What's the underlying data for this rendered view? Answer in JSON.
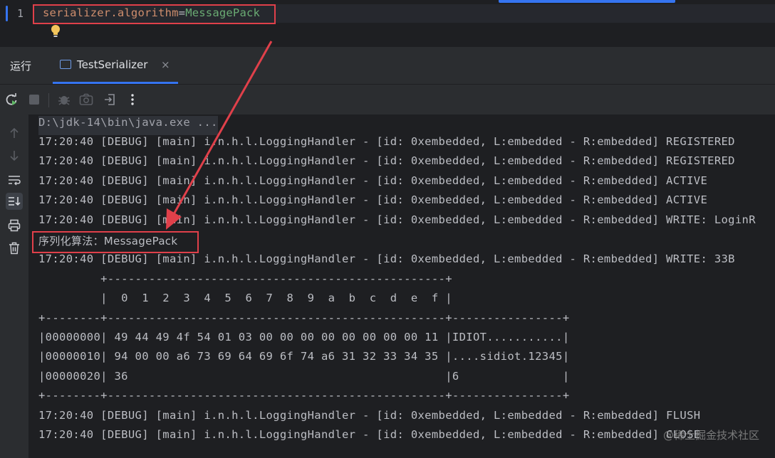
{
  "editor": {
    "line_number": "1",
    "code_key": "serializer.algorithm",
    "code_eq": "=",
    "code_value": "MessagePack"
  },
  "tabs": {
    "run_label": "运行",
    "active_tab": "TestSerializer",
    "close_glyph": "×"
  },
  "console": {
    "lines": [
      "D:\\jdk-14\\bin\\java.exe ...",
      "17:20:40 [DEBUG] [main] i.n.h.l.LoggingHandler - [id: 0xembedded, L:embedded - R:embedded] REGISTERED",
      "17:20:40 [DEBUG] [main] i.n.h.l.LoggingHandler - [id: 0xembedded, L:embedded - R:embedded] REGISTERED",
      "17:20:40 [DEBUG] [main] i.n.h.l.LoggingHandler - [id: 0xembedded, L:embedded - R:embedded] ACTIVE",
      "17:20:40 [DEBUG] [main] i.n.h.l.LoggingHandler - [id: 0xembedded, L:embedded - R:embedded] ACTIVE",
      "17:20:40 [DEBUG] [main] i.n.h.l.LoggingHandler - [id: 0xembedded, L:embedded - R:embedded] WRITE: LoginR",
      "序列化算法：MessagePack",
      "17:20:40 [DEBUG] [main] i.n.h.l.LoggingHandler - [id: 0xembedded, L:embedded - R:embedded] WRITE: 33B",
      "         +-------------------------------------------------+",
      "         |  0  1  2  3  4  5  6  7  8  9  a  b  c  d  e  f |",
      "+--------+-------------------------------------------------+----------------+",
      "|00000000| 49 44 49 4f 54 01 03 00 00 00 00 00 00 00 00 11 |IDIOT...........|",
      "|00000010| 94 00 00 a6 73 69 64 69 6f 74 a6 31 32 33 34 35 |....sidiot.12345|",
      "|00000020| 36                                              |6               |",
      "+--------+-------------------------------------------------+----------------+",
      "17:20:40 [DEBUG] [main] i.n.h.l.LoggingHandler - [id: 0xembedded, L:embedded - R:embedded] FLUSH",
      "17:20:40 [DEBUG] [main] i.n.h.l.LoggingHandler - [id: 0xembedded, L:embedded - R:embedded] CLOSE"
    ]
  },
  "watermark": "@稀土掘金技术社区",
  "colors": {
    "highlight_box": "#e0404a",
    "arrow": "#e0404a",
    "accent": "#3574f0"
  },
  "icons": {
    "toolbar": [
      "rerun-icon",
      "stop-icon",
      "debug-icon",
      "camera-icon",
      "exit-icon",
      "more-icon"
    ],
    "sidebar": [
      "arrow-up-icon",
      "arrow-down-icon",
      "soft-wrap-icon",
      "scroll-to-end-icon",
      "print-icon",
      "trash-icon"
    ]
  }
}
